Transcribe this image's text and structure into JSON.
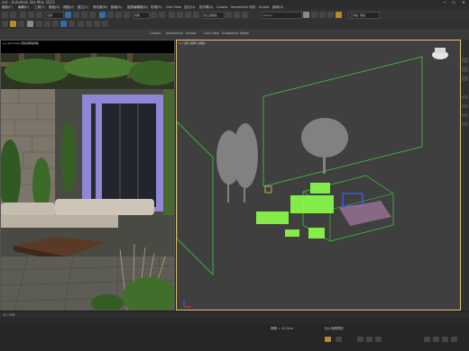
{
  "window": {
    "title": "ne) - Autodesk 3ds Max 2023",
    "controls": [
      "—",
      "☐",
      "✕"
    ]
  },
  "menubar": {
    "items": [
      "檔案(F)",
      "編輯(E)",
      "工具(T)",
      "群組(G)",
      "視圖(V)",
      "建立(C)",
      "修改器(M)",
      "動畫(A)",
      "圖表編輯器(D)",
      "彩現(R)",
      "Civil View",
      "自訂(U)",
      "指令碼(S)",
      "Corona",
      "Interactive",
      "內容",
      "Arnold",
      "說明(H)"
    ]
  },
  "toolbar": {
    "selection_filter": "全部",
    "named_selection": "建立選取集",
    "view_dropdown": "視圖",
    "user_field": "Sign In",
    "workspace": "工作區: 預設"
  },
  "ribbon_tabs": [
    "Corona",
    "Interactive",
    "Arnold",
    "Civil View",
    "Substance",
    "Tyflow"
  ],
  "left_viewport": {
    "label": "[+] [Corona] [預設明暗處理]"
  },
  "right_viewport": {
    "label": "[+] [頂] [標準] [線框]"
  },
  "status": {
    "frame": "0 / 100",
    "grid": "柵格 = 10.0cm",
    "time_tag": "加入時間標記"
  },
  "colors": {
    "active_border": "#e8c36b",
    "wire_green": "#3ccf3c",
    "bright_green": "#8cff4a",
    "blue_obj": "#3a5ff0"
  }
}
